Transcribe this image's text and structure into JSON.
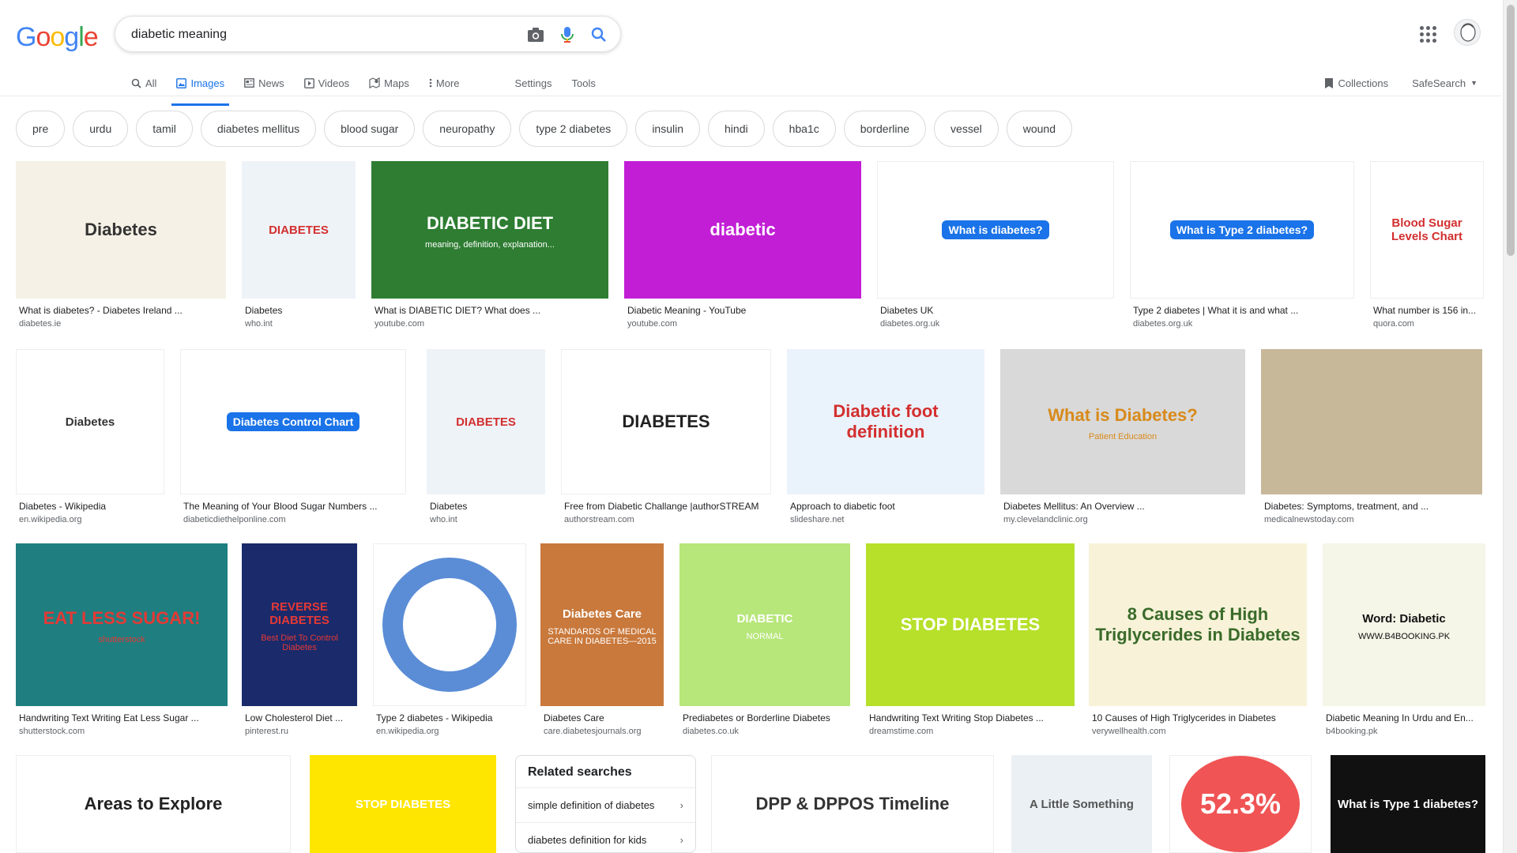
{
  "logo": {
    "letters": [
      "G",
      "o",
      "o",
      "g",
      "l",
      "e"
    ],
    "colors": [
      "#4285F4",
      "#EA4335",
      "#FBBC05",
      "#4285F4",
      "#34A853",
      "#EA4335"
    ]
  },
  "search": {
    "query": "diabetic meaning",
    "icons": [
      "camera-icon",
      "microphone-icon",
      "search-icon"
    ]
  },
  "tabs": [
    {
      "label": "All",
      "icon": "search-icon",
      "active": false
    },
    {
      "label": "Images",
      "icon": "image-icon",
      "active": true
    },
    {
      "label": "News",
      "icon": "news-icon",
      "active": false
    },
    {
      "label": "Videos",
      "icon": "video-icon",
      "active": false
    },
    {
      "label": "Maps",
      "icon": "map-icon",
      "active": false
    },
    {
      "label": "More",
      "icon": "dots-vertical-icon",
      "active": false
    }
  ],
  "tools": {
    "settings": "Settings",
    "tools": "Tools"
  },
  "right_tools": {
    "collections": "Collections",
    "safesearch": "SafeSearch"
  },
  "chips": [
    "pre",
    "urdu",
    "tamil",
    "diabetes mellitus",
    "blood sugar",
    "neuropathy",
    "type 2 diabetes",
    "insulin",
    "hindi",
    "hba1c",
    "borderline",
    "vessel",
    "wound"
  ],
  "results": [
    {
      "title": "What is diabetes? - Diabetes Ireland ...",
      "site": "diabetes.ie",
      "thumb_text": "Diabetes",
      "bg": "#f5f1e6",
      "fg": "#333"
    },
    {
      "title": "Diabetes",
      "site": "who.int",
      "thumb_text": "DIABETES",
      "bg": "#eef3f8",
      "fg": "#d32f2f"
    },
    {
      "title": "What is DIABETIC DIET? What does ...",
      "site": "youtube.com",
      "thumb_text": "DIABETIC DIET",
      "thumb_sub": "meaning, definition, explanation...",
      "bg": "#2e7d32",
      "fg": "#fff"
    },
    {
      "title": "Diabetic Meaning - YouTube",
      "site": "youtube.com",
      "thumb_text": "diabetic",
      "bg": "#c21ed6",
      "fg": "#fff"
    },
    {
      "title": "Diabetes UK",
      "site": "diabetes.org.uk",
      "thumb_text": "What is diabetes?",
      "bg": "#fff",
      "fg": "#fff"
    },
    {
      "title": "Type 2 diabetes | What it is and what ...",
      "site": "diabetes.org.uk",
      "thumb_text": "What is Type 2 diabetes?",
      "bg": "#fff",
      "fg": "#fff"
    },
    {
      "title": "What number is 156 in...",
      "site": "quora.com",
      "thumb_text": "Blood Sugar Levels Chart",
      "bg": "#fff",
      "fg": "#d32f2f"
    },
    {
      "title": "Diabetes - Wikipedia",
      "site": "en.wikipedia.org",
      "thumb_text": "Diabetes",
      "bg": "#fff",
      "fg": "#333"
    },
    {
      "title": "The Meaning of Your Blood Sugar Numbers ...",
      "site": "diabeticdiethelponline.com",
      "thumb_text": "Diabetes Control Chart",
      "bg": "#fff",
      "fg": "#fff"
    },
    {
      "title": "Diabetes",
      "site": "who.int",
      "thumb_text": "DIABETES",
      "bg": "#eef3f8",
      "fg": "#d32f2f"
    },
    {
      "title": "Free from Diabetic Challange |authorSTREAM",
      "site": "authorstream.com",
      "thumb_text": "DIABETES",
      "bg": "#fff",
      "fg": "#222"
    },
    {
      "title": "Approach to diabetic foot",
      "site": "slideshare.net",
      "thumb_text": "Diabetic foot definition",
      "bg": "#eaf2fb",
      "fg": "#d32f2f"
    },
    {
      "title": "Diabetes Mellitus: An Overview ...",
      "site": "my.clevelandclinic.org",
      "thumb_text": "What is Diabetes?",
      "thumb_sub": "Patient Education",
      "bg": "#d9d9d9",
      "fg": "#d88a1a"
    },
    {
      "title": "Diabetes: Symptoms, treatment, and ...",
      "site": "medicalnewstoday.com",
      "thumb_text": "",
      "bg": "#c8b89a",
      "fg": "#333"
    },
    {
      "title": "Handwriting Text Writing Eat Less Sugar ...",
      "site": "shutterstock.com",
      "thumb_text": "EAT LESS SUGAR!",
      "thumb_sub": "shutterstock",
      "bg": "#1f7f80",
      "fg": "#e53935"
    },
    {
      "title": "Low Cholesterol Diet ...",
      "site": "pinterest.ru",
      "thumb_text": "REVERSE DIABETES",
      "thumb_sub": "Best Diet To Control Diabetes",
      "bg": "#1b2a6b",
      "fg": "#e53935"
    },
    {
      "title": "Type 2 diabetes - Wikipedia",
      "site": "en.wikipedia.org",
      "thumb_text": "",
      "bg": "#fff",
      "fg": "#5b8dd6"
    },
    {
      "title": "Diabetes Care",
      "site": "care.diabetesjournals.org",
      "thumb_text": "Diabetes Care",
      "thumb_sub": "STANDARDS OF MEDICAL CARE IN DIABETES—2015",
      "bg": "#c9793c",
      "fg": "#fff"
    },
    {
      "title": "Prediabetes or Borderline Diabetes",
      "site": "diabetes.co.uk",
      "thumb_text": "DIABETIC",
      "thumb_sub": "NORMAL",
      "bg": "#b7e67a",
      "fg": "#fff"
    },
    {
      "title": "Handwriting Text Writing Stop Diabetes ...",
      "site": "dreamstime.com",
      "thumb_text": "STOP DIABETES",
      "bg": "#b6e02a",
      "fg": "#fff"
    },
    {
      "title": "10 Causes of High Triglycerides in Diabetes",
      "site": "verywellhealth.com",
      "thumb_text": "8 Causes of High Triglycerides in Diabetes",
      "bg": "#f7f2d8",
      "fg": "#3a6b2a"
    },
    {
      "title": "Diabetic Meaning In Urdu and En...",
      "site": "b4booking.pk",
      "thumb_text": "Word: Diabetic",
      "thumb_sub": "WWW.B4BOOKING.PK",
      "bg": "#f5f5e8",
      "fg": "#111"
    },
    {
      "title": "",
      "site": "",
      "thumb_text": "Areas to Explore",
      "bg": "#fff",
      "fg": "#222"
    },
    {
      "title": "",
      "site": "",
      "thumb_text": "STOP DIABETES",
      "bg": "#ffe600",
      "fg": "#fff"
    },
    {
      "title": "",
      "site": "",
      "thumb_text": "DPP & DPPOS Timeline",
      "bg": "#fff",
      "fg": "#333"
    },
    {
      "title": "",
      "site": "",
      "thumb_text": "A Little Something",
      "bg": "#eaf0f3",
      "fg": "#555"
    },
    {
      "title": "",
      "site": "",
      "thumb_text": "52.3%",
      "bg": "#fff",
      "fg": "#fff"
    },
    {
      "title": "",
      "site": "",
      "thumb_text": "What is Type 1 diabetes?",
      "bg": "#111",
      "fg": "#fff"
    }
  ],
  "related": {
    "heading": "Related searches",
    "items": [
      "simple definition of diabetes",
      "diabetes definition for kids"
    ]
  },
  "colors": {
    "accent": "#1a73e8",
    "text_secondary": "#5f6368"
  }
}
